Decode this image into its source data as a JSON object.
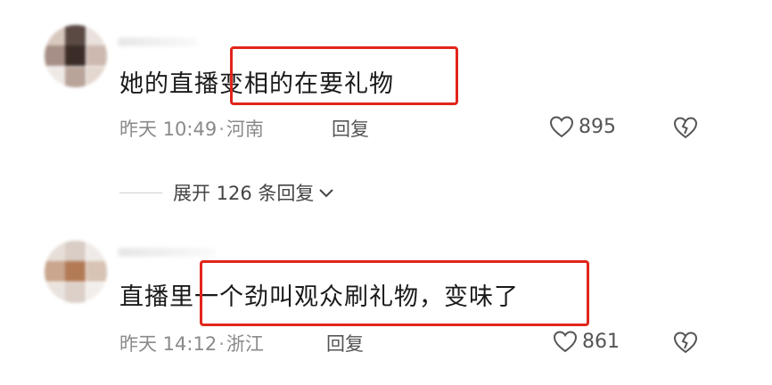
{
  "comments": [
    {
      "text": "她的直播变相的在要礼物",
      "time": "昨天 10:49",
      "separator": "·",
      "location": "河南",
      "reply_label": "回复",
      "likes": "895",
      "avatar_colors": [
        "#d8c9bf",
        "#5b4a44",
        "#e9e1dc",
        "#a68f86",
        "#3b2c28",
        "#cdb9af",
        "#efe9e6",
        "#b9a49a",
        "#e3d7d0"
      ]
    },
    {
      "text": "直播里一个劲叫观众刷礼物，变味了",
      "time": "昨天 14:12",
      "separator": "·",
      "location": "浙江",
      "reply_label": "回复",
      "likes": "861",
      "avatar_colors": [
        "#e7ded8",
        "#d9cdc6",
        "#f0ebe8",
        "#c9a68d",
        "#b27a55",
        "#d8c3b4",
        "#e9e2dd",
        "#dcd0c8",
        "#f2eeeb"
      ]
    }
  ],
  "expand_replies": {
    "label": "展开 126 条回复"
  },
  "accent": {
    "highlight": "#e1251b",
    "meta_text": "#8a8a8a"
  }
}
